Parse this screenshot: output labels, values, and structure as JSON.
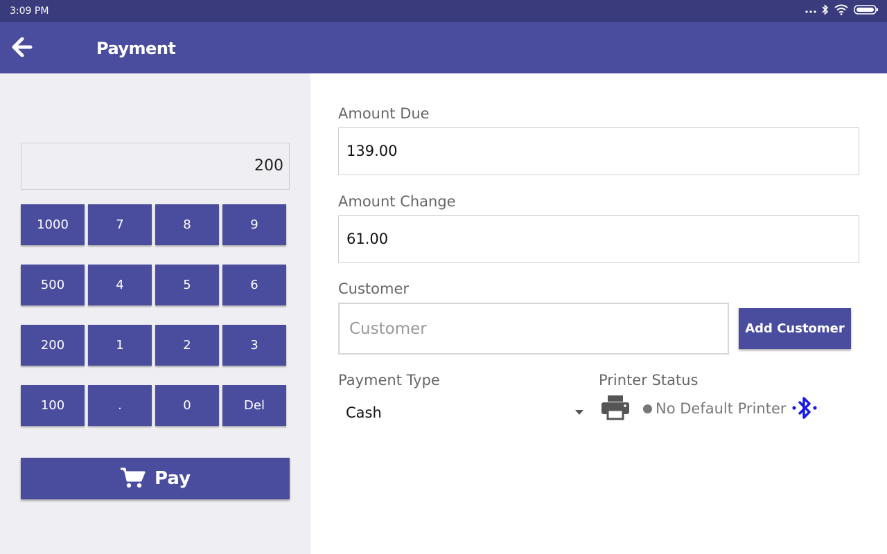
{
  "status_bar": {
    "time": "3:09 PM",
    "icons": [
      "more-dots-icon",
      "bluetooth-icon",
      "wifi-icon",
      "battery-icon"
    ]
  },
  "app_bar": {
    "title": "Payment",
    "back_icon": "arrow-left-icon"
  },
  "keypad": {
    "display_value": "200",
    "keys": [
      [
        "1000",
        "7",
        "8",
        "9"
      ],
      [
        "500",
        "4",
        "5",
        "6"
      ],
      [
        "200",
        "1",
        "2",
        "3"
      ],
      [
        "100",
        ".",
        "0",
        "Del"
      ]
    ],
    "pay_label": "Pay",
    "pay_icon": "cart-icon"
  },
  "form": {
    "amount_due_label": "Amount Due",
    "amount_due_value": "139.00",
    "amount_change_label": "Amount Change",
    "amount_change_value": "61.00",
    "customer_label": "Customer",
    "customer_placeholder": "Customer",
    "customer_value": "",
    "add_customer_label": "Add Customer",
    "payment_type_label": "Payment Type",
    "payment_type_value": "Cash",
    "printer_status_label": "Printer Status",
    "printer_status_text": "No Default Printer"
  },
  "colors": {
    "primary": "#4a4c9e",
    "status_bar": "#3a3b7c",
    "panel_bg": "#efeff3",
    "bluetooth": "#1a1ae6",
    "status_dot": "#777777"
  }
}
